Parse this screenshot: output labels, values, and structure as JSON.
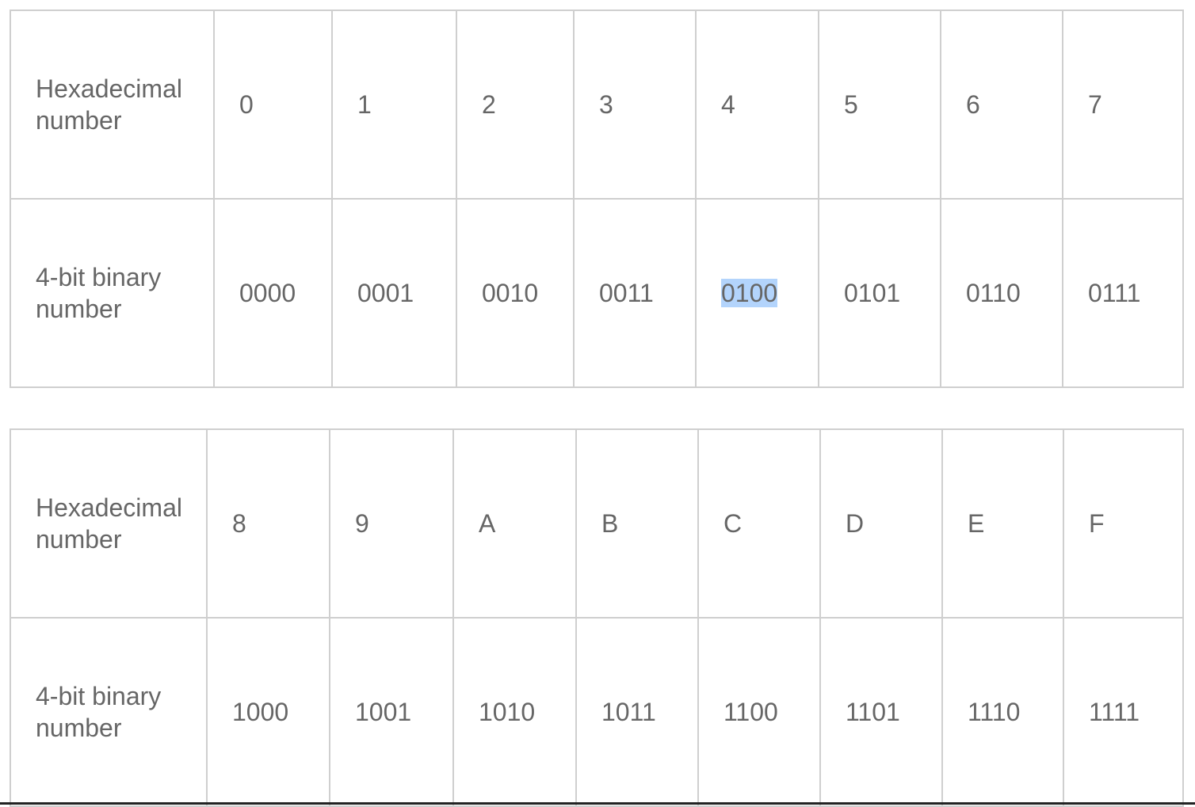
{
  "tables": [
    {
      "hex_label": "Hexadecimal number",
      "bin_label": "4-bit binary number",
      "hex": [
        "0",
        "1",
        "2",
        "3",
        "4",
        "5",
        "6",
        "7"
      ],
      "bin": [
        "0000",
        "0001",
        "0010",
        "0011",
        "0100",
        "0101",
        "0110",
        "0111"
      ]
    },
    {
      "hex_label": "Hexadecimal number",
      "bin_label": "4-bit binary number",
      "hex": [
        "8",
        "9",
        "A",
        "B",
        "C",
        "D",
        "E",
        "F"
      ],
      "bin": [
        "1000",
        "1001",
        "1010",
        "1011",
        "1100",
        "1101",
        "1110",
        "1111"
      ]
    }
  ],
  "selection": {
    "table": 0,
    "row": "bin",
    "index": 4,
    "highlight_color": "#b3d4fc"
  }
}
